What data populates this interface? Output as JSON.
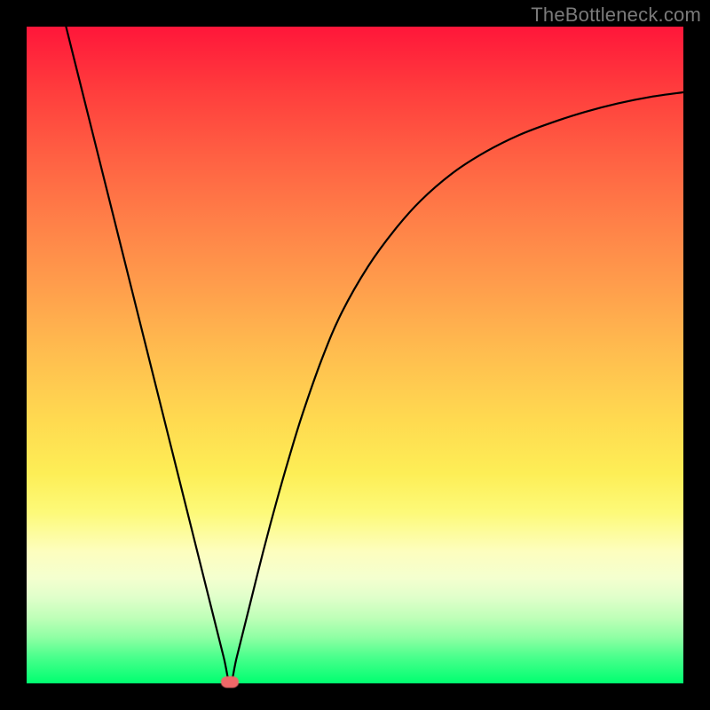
{
  "watermark": "TheBottleneck.com",
  "colors": {
    "frame": "#000000",
    "curve": "#000000",
    "marker": "#ef6868",
    "gradient_top": "#ff163a",
    "gradient_bottom": "#00ff70"
  },
  "chart_data": {
    "type": "line",
    "title": "",
    "xlabel": "",
    "ylabel": "",
    "xlim": [
      0,
      100
    ],
    "ylim": [
      0,
      100
    ],
    "annotations": [
      {
        "text": "TheBottleneck.com",
        "position": "top-right"
      }
    ],
    "marker_point": {
      "x": 31,
      "y": 0
    },
    "series": [
      {
        "name": "bottleneck-curve",
        "x": [
          6,
          8,
          10,
          12,
          14,
          16,
          18,
          20,
          22,
          24,
          26,
          28,
          30,
          31,
          32,
          34,
          36,
          38,
          40,
          42,
          45,
          48,
          52,
          56,
          60,
          65,
          70,
          75,
          80,
          85,
          90,
          95,
          100
        ],
        "values": [
          100,
          92,
          84,
          76,
          68,
          60,
          52,
          44,
          36,
          28,
          20,
          12,
          4,
          0,
          4,
          12,
          20,
          27.5,
          34.5,
          41,
          49.5,
          56.5,
          63.5,
          69,
          73.5,
          77.8,
          81,
          83.5,
          85.4,
          87,
          88.3,
          89.3,
          90
        ]
      }
    ]
  }
}
